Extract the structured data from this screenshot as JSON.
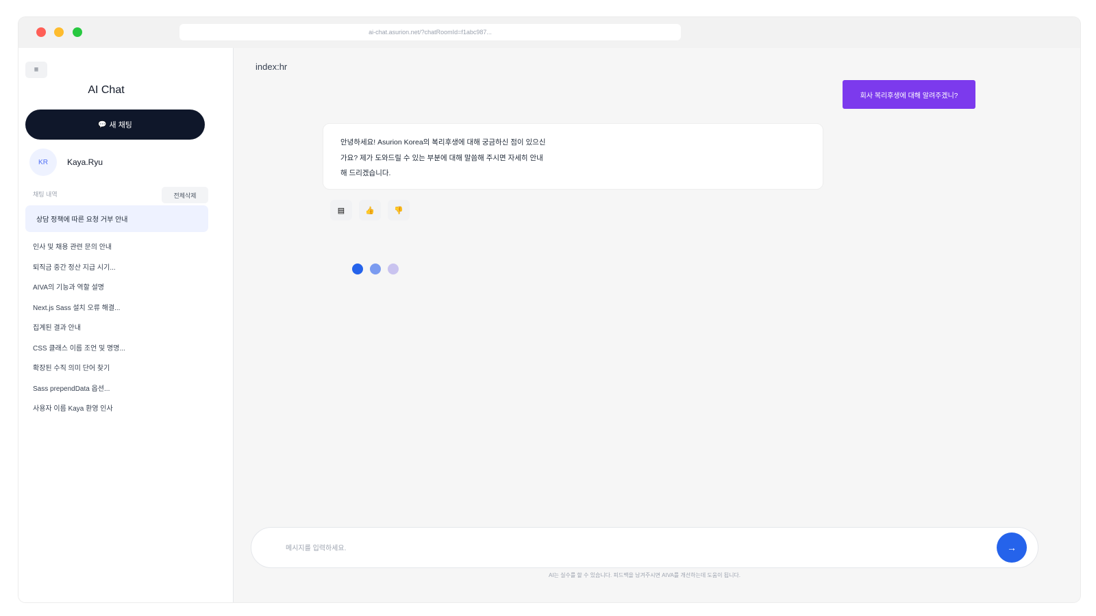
{
  "browser": {
    "url": "ai-chat.asurion.net/?chatRoomId=f1abc987..."
  },
  "sidebar": {
    "menu_icon": "≡",
    "app_title": "AI Chat",
    "new_chat_icon": "💬",
    "new_chat_label": "새 채팅",
    "user": {
      "initials": "KR",
      "name": "Kaya.Ryu"
    },
    "history_label": "채팅 내역",
    "delete_all_label": "전체삭제",
    "active_item": "상담 정책에 따른 요청 거부 안내",
    "items": [
      {
        "label": "인사 및 채용 관련 문의 안내"
      },
      {
        "label": "퇴직금 중간 정산 지급 시기..."
      },
      {
        "label": "AIVA의 기능과 역할 설명"
      },
      {
        "label": "Next.js Sass 설치 오류 해결..."
      },
      {
        "label": "집계된 결과 안내"
      },
      {
        "label": "CSS 클래스 이름 조언 및 명명..."
      },
      {
        "label": "확장된 수직 의미 단어 찾기"
      },
      {
        "label": "Sass prependData 옵션..."
      },
      {
        "label": "사용자 이름 Kaya 환영 인사"
      }
    ]
  },
  "main": {
    "context_label": "index:hr",
    "user_message": "회사 복리후생에 대해 알려주겠니?",
    "ai_message": "안녕하세요! Asurion Korea의 복리후생에 대해 궁금하신 점이 있으신가요? 제가 도와드릴 수 있는 부분에 대해 말씀해 주시면 자세히 안내해 드리겠습니다.",
    "actions": {
      "copy_icon": "▤",
      "like_icon": "👍",
      "dislike_icon": "👎"
    },
    "input_placeholder": "메시지를 입력하세요.",
    "send_icon": "→",
    "disclaimer": "AI는 실수를 할 수 있습니다. 피드백을 남겨주시면 AIVA를 개선하는데 도움이 됩니다."
  },
  "colors": {
    "accent_purple": "#7c3aed",
    "accent_blue": "#2563eb",
    "new_chat_bg": "#0f172a",
    "active_history_bg": "#eef2ff"
  }
}
